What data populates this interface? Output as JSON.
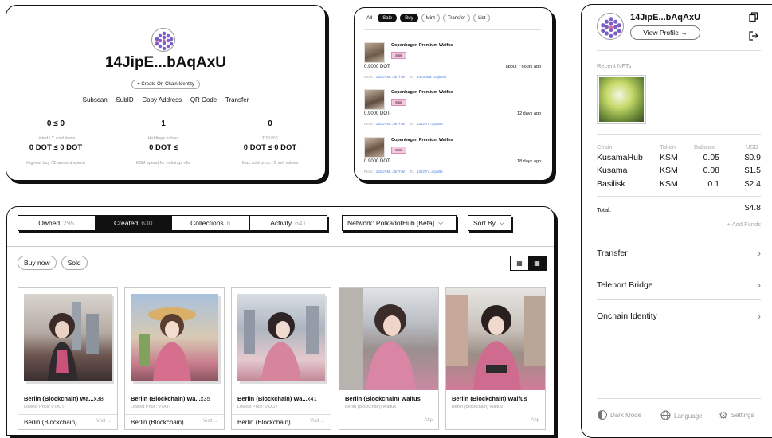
{
  "profile": {
    "name": "14JipE...bAqAxU",
    "create_identity": "+ Create On-Chain Identity",
    "links": [
      "Subscan",
      "SubID",
      "Copy Address",
      "QR Code",
      "Transfer"
    ],
    "stats": [
      {
        "value": "0 ≤ 0",
        "label": "Listed / Σ sold items",
        "big": "0 DOT ≤ 0 DOT",
        "big_label": "Highest buy / Σ amount spend"
      },
      {
        "value": "1",
        "label": "Holdings values",
        "big": "0 DOT ≤",
        "big_label": "KSM spend for holdings nfts"
      },
      {
        "value": "0",
        "label": "Σ BUYS",
        "big": "0 DOT ≤ 0 DOT",
        "big_label": "Max sold price / Σ sell values"
      }
    ]
  },
  "activity": {
    "filters": [
      "All",
      "Sale",
      "Buy",
      "Mint",
      "Transfer",
      "List"
    ],
    "active_filters": [
      "Sale",
      "Buy"
    ],
    "items": [
      {
        "title": "Copenhagen Premium Waifus",
        "badge": "Sale",
        "price": "0.9000 DOT",
        "time": "about 7 hours ago",
        "from_label": "From:",
        "from": "15CoYM...SkYhW",
        "to_label": "To:",
        "to": "14K9mra...c8jMNo"
      },
      {
        "title": "Copenhagen Premium Waifus",
        "badge": "Sale",
        "price": "0.9000 DOT",
        "time": "12 days ago",
        "from_label": "From:",
        "from": "15CoYM...SkYhW",
        "to_label": "To:",
        "to": "13s37n...drpvBe"
      },
      {
        "title": "Copenhagen Premium Waifus",
        "badge": "Sale",
        "price": "0.9000 DOT",
        "time": "18 days ago",
        "from_label": "From:",
        "from": "15CoYM...SkYhW",
        "to_label": "To:",
        "to": "13s37n...drpvBe"
      }
    ]
  },
  "tabs": [
    {
      "label": "Owned",
      "count": "295"
    },
    {
      "label": "Created",
      "count": "630"
    },
    {
      "label": "Collections",
      "count": "6"
    },
    {
      "label": "Activity",
      "count": "641"
    }
  ],
  "network_select": "Network: PolkadotHub [Beta]",
  "sort_select": "Sort By",
  "filters": {
    "buy_now": "Buy now",
    "sold": "Sold"
  },
  "nfts": [
    {
      "title": "Berlin (Blockchain) Wa...",
      "count": "x38",
      "sub": "Lowest Price: 0 DOT",
      "foot": "Berlin (Blockchain) ...",
      "foot_right": "Visit →"
    },
    {
      "title": "Berlin (Blockchain) Wa...",
      "count": "x35",
      "sub": "Lowest Price: 0 DOT",
      "foot": "Berlin (Blockchain) ...",
      "foot_right": "Visit →"
    },
    {
      "title": "Berlin (Blockchain) Wa...",
      "count": "x41",
      "sub": "Lowest Price: 0 DOT",
      "foot": "Berlin (Blockchain) ...",
      "foot_right": "Visit →"
    },
    {
      "title": "Berlin (Blockchain) Waifus",
      "count": "",
      "sub": "Berlin (Blockchain) Waifus",
      "foot": "",
      "foot_right": "Ahp"
    },
    {
      "title": "Berlin (Blockchain) Waifus",
      "count": "",
      "sub": "Berlin (Blockchain) Waifus",
      "foot": "",
      "foot_right": "Ahp"
    }
  ],
  "wallet": {
    "name": "14JipE...bAqAxU",
    "view_profile": "View Profile →",
    "recent_label": "Recent NFTs",
    "table_headers": [
      "Chain",
      "Token",
      "Balance",
      "USD"
    ],
    "rows": [
      {
        "chain": "KusamaHub",
        "token": "KSM",
        "balance": "0.05",
        "usd": "$0.9"
      },
      {
        "chain": "Kusama",
        "token": "KSM",
        "balance": "0.08",
        "usd": "$1.5"
      },
      {
        "chain": "Basilisk",
        "token": "KSM",
        "balance": "0.1",
        "usd": "$2.4"
      }
    ],
    "total_label": "Total:",
    "total_value": "$4.8",
    "add_funds": "+ Add Funds",
    "menu": [
      "Transfer",
      "Teleport Bridge",
      "Onchain Identity"
    ],
    "footer": {
      "dark_mode": "Dark Mode",
      "language": "Language",
      "settings": "Settings"
    }
  },
  "colors": {
    "accent_link": "#4a7de0",
    "badge_bg": "#f7c6e0",
    "ink": "#111111"
  }
}
